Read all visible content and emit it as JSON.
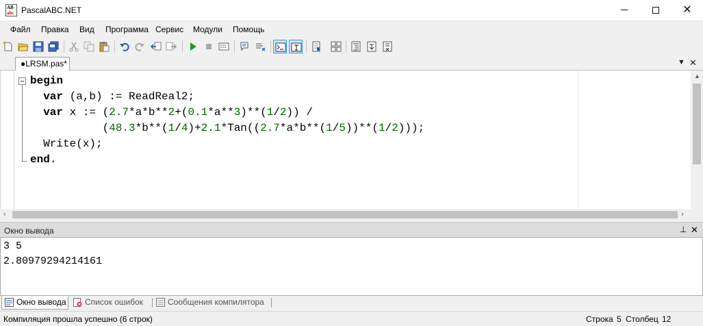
{
  "window": {
    "title": "PascalABC.NET",
    "icon_text_top": "AB",
    "icon_text_bottom": "abc"
  },
  "menu": [
    "Файл",
    "Правка",
    "Вид",
    "Программа",
    "Сервис",
    "Модули",
    "Помощь"
  ],
  "toolbar_icons": [
    "new-file-icon",
    "open-icon",
    "save-icon",
    "save-all-icon",
    "cut-icon",
    "copy-icon",
    "paste-icon",
    "undo-icon",
    "redo-icon",
    "navigate-back-icon",
    "navigate-forward-icon",
    "run-icon",
    "stop-icon",
    "compile-icon",
    "comment-icon",
    "uncomment-icon",
    "console-icon",
    "text-icon",
    "debug-icon",
    "watch-icon",
    "format-icon",
    "step-into-icon",
    "step-over-icon"
  ],
  "editor_tab": {
    "label": "●LRSM.pas*"
  },
  "code_lines": [
    [
      {
        "t": "begin",
        "c": "kw"
      }
    ],
    [
      {
        "t": "  "
      },
      {
        "t": "var",
        "c": "kw"
      },
      {
        "t": " (a,b) := ReadReal2;"
      }
    ],
    [
      {
        "t": "  "
      },
      {
        "t": "var",
        "c": "kw"
      },
      {
        "t": " x := ("
      },
      {
        "t": "2.7",
        "c": "num"
      },
      {
        "t": "*a*b**"
      },
      {
        "t": "2",
        "c": "num"
      },
      {
        "t": "+("
      },
      {
        "t": "0.1",
        "c": "num"
      },
      {
        "t": "*a**"
      },
      {
        "t": "3",
        "c": "num"
      },
      {
        "t": ")**("
      },
      {
        "t": "1",
        "c": "num"
      },
      {
        "t": "/"
      },
      {
        "t": "2",
        "c": "num"
      },
      {
        "t": ")) /"
      }
    ],
    [
      {
        "t": "           ("
      },
      {
        "t": "48.3",
        "c": "num"
      },
      {
        "t": "*b**("
      },
      {
        "t": "1",
        "c": "num"
      },
      {
        "t": "/"
      },
      {
        "t": "4",
        "c": "num"
      },
      {
        "t": ")+"
      },
      {
        "t": "2.1",
        "c": "num"
      },
      {
        "t": "*Tan(("
      },
      {
        "t": "2.7",
        "c": "num"
      },
      {
        "t": "*a*b**("
      },
      {
        "t": "1",
        "c": "num"
      },
      {
        "t": "/"
      },
      {
        "t": "5",
        "c": "num"
      },
      {
        "t": "))**("
      },
      {
        "t": "1",
        "c": "num"
      },
      {
        "t": "/"
      },
      {
        "t": "2",
        "c": "num"
      },
      {
        "t": ")));"
      }
    ],
    [
      {
        "t": "  Write(x);"
      }
    ],
    [
      {
        "t": "end",
        "c": "kw"
      },
      {
        "t": "."
      }
    ]
  ],
  "output_panel": {
    "title": "Окно вывода",
    "lines": [
      "3 5",
      "2.80979294214161"
    ]
  },
  "bottom_tabs": [
    {
      "label": "Окно вывода",
      "icon": "output-window-icon",
      "active": true
    },
    {
      "label": "Список ошибок",
      "icon": "error-list-icon",
      "active": false
    },
    {
      "label": "Сообщения компилятора",
      "icon": "compiler-messages-icon",
      "active": false
    }
  ],
  "status": {
    "message": "Компиляция прошла успешно (6 строк)",
    "line_label": "Строка",
    "line_value": "5",
    "col_label": "Столбец",
    "col_value": "12"
  },
  "colors": {
    "keyword": "#000000",
    "number": "#006400",
    "pressed_button": "#cce4f7",
    "pressed_border": "#3399ff"
  }
}
